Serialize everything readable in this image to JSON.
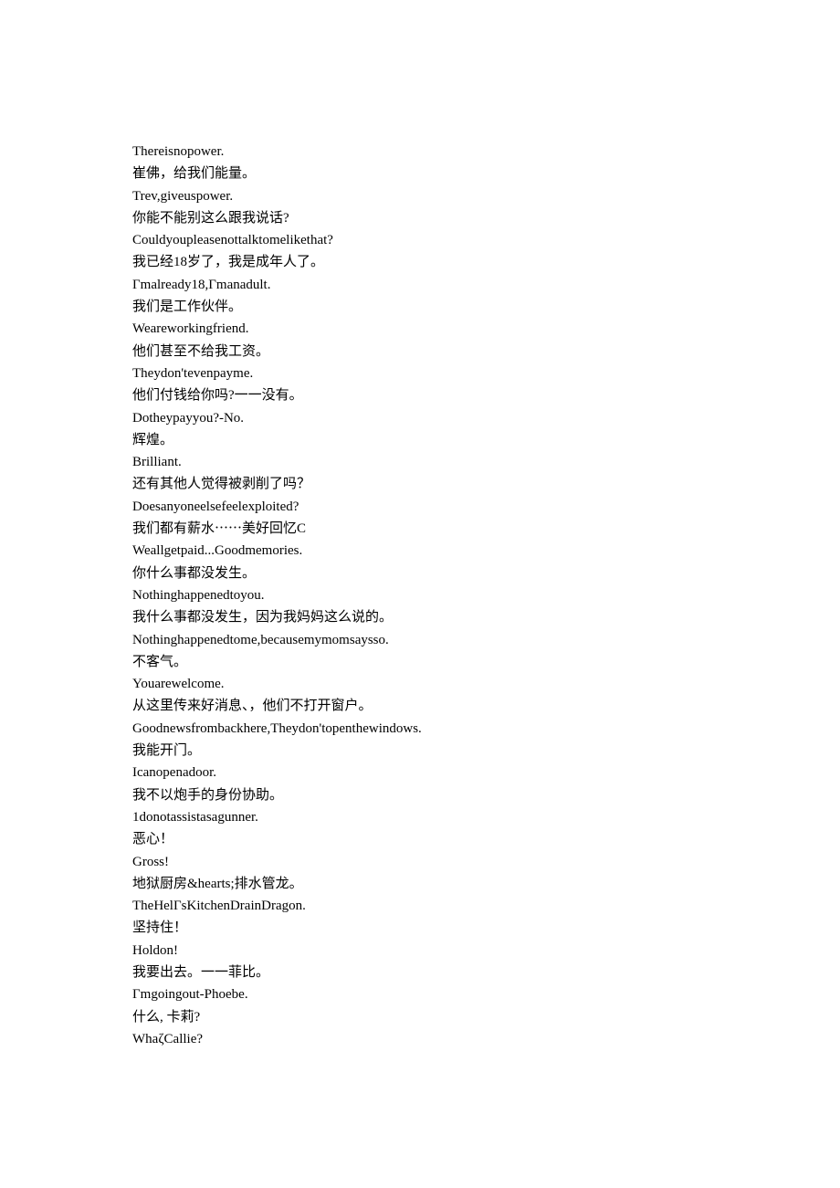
{
  "lines": [
    "Thereisnopower.",
    "崔佛，给我们能量。",
    "Trev,giveuspower.",
    "你能不能别这么跟我说话?",
    "Couldyoupleasenottalktomelikethat?",
    "我已经18岁了，我是成年人了。",
    "Γmalready18,Γmanadult.",
    "我们是工作伙伴。",
    "Weareworkingfriend.",
    "他们甚至不给我工资。",
    "Theydon'tevenpayme.",
    "他们付钱给你吗?一一没有。",
    "Dotheypayyou?-No.",
    "辉煌。",
    "Brilliant.",
    "还有其他人觉得被剥削了吗？",
    "Doesanyoneelsefeelexploited?",
    "我们都有薪水⋯⋯美好回忆C",
    "Weallgetpaid...Goodmemories.",
    "你什么事都没发生。",
    "Nothinghappenedtoyou.",
    "我什么事都没发生，因为我妈妈这么说的。",
    "Nothinghappenedtome,becausemymomsaysso.",
    "不客气。",
    "Youarewelcome.",
    "从这里传来好消息、，他们不打开窗户。",
    "Goodnewsfrombackhere,Theydon'topenthewindows.",
    "我能开门。",
    "Icanopenadoor.",
    "我不以炮手的身份协助。",
    "1donotassistasagunner.",
    "恶心！",
    "Gross!",
    "地狱厨房&hearts;排水管龙。",
    "TheHelΓsKitchenDrainDragon.",
    "坚持住！",
    "Holdon!",
    "我要出去。一一菲比。",
    "Γmgoingout-Phoebe.",
    "什么, 卡莉?",
    "WhaζCallie?"
  ]
}
